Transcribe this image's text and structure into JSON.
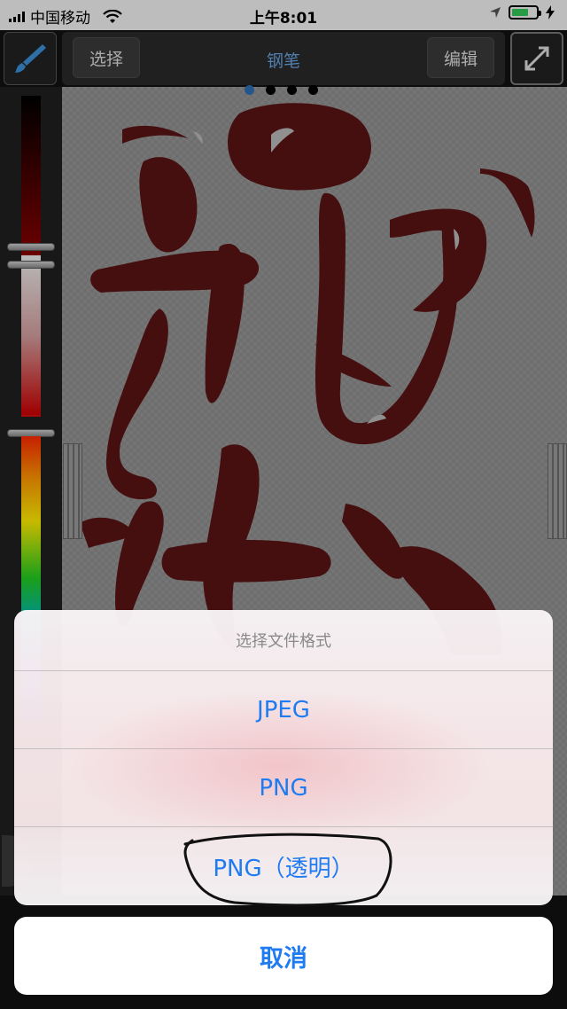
{
  "status_bar": {
    "carrier": "中国移动",
    "time": "上午8:01"
  },
  "toolbar": {
    "select_label": "选择",
    "title": "钢笔",
    "edit_label": "编辑"
  },
  "page_indicator": {
    "count": 4,
    "active_index": 0
  },
  "action_sheet": {
    "title": "选择文件格式",
    "options": [
      "JPEG",
      "PNG",
      "PNG（透明）"
    ],
    "cancel_label": "取消"
  },
  "colors": {
    "accent": "#1f7bf2",
    "ink": "#5a1414",
    "toolbar_title": "#6aa3e0"
  },
  "icons": {
    "toolbar_left": "brush-icon",
    "toolbar_right": "expand-icon"
  }
}
